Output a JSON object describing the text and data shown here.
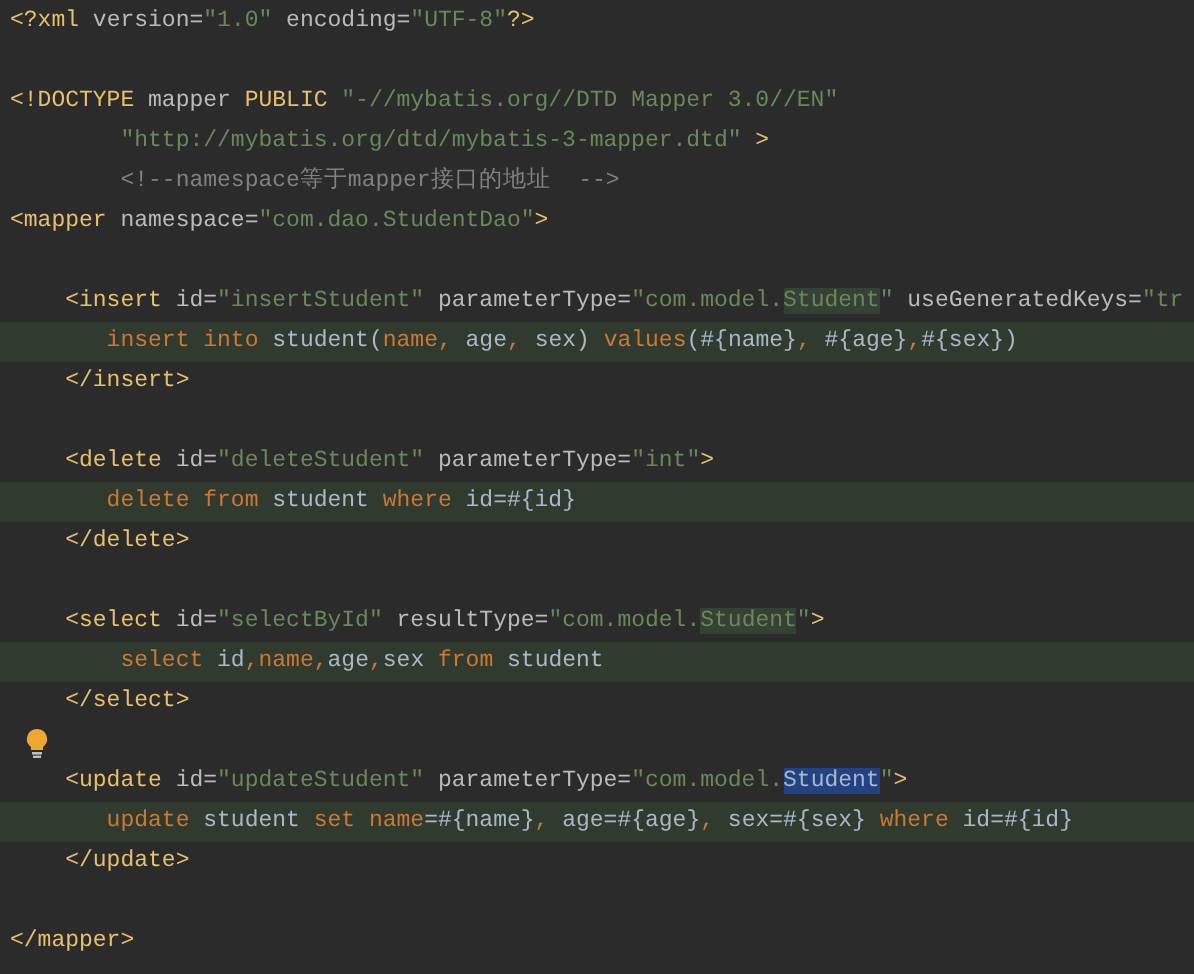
{
  "editor": {
    "lines": [
      {
        "kind": "code",
        "injected": false,
        "segments": [
          {
            "text": "<?xml",
            "kind": "tag"
          },
          {
            "text": " version=",
            "kind": "attr"
          },
          {
            "text": "\"1.0\"",
            "kind": "value"
          },
          {
            "text": " encoding=",
            "kind": "attr"
          },
          {
            "text": "\"UTF-8\"",
            "kind": "value"
          },
          {
            "text": "?>",
            "kind": "tag"
          }
        ]
      },
      {
        "kind": "blank"
      },
      {
        "kind": "code",
        "injected": false,
        "segments": [
          {
            "text": "<!DOCTYPE",
            "kind": "tag"
          },
          {
            "text": " mapper",
            "kind": "attr"
          },
          {
            "text": " PUBLIC",
            "kind": "tag"
          },
          {
            "text": " \"-//mybatis.org//DTD Mapper 3.0//EN\"",
            "kind": "value"
          }
        ]
      },
      {
        "kind": "code",
        "injected": false,
        "segments": [
          {
            "text": "        \"http://mybatis.org/dtd/mybatis-3-mapper.dtd\"",
            "kind": "value"
          },
          {
            "text": " >",
            "kind": "tag"
          }
        ]
      },
      {
        "kind": "code",
        "injected": false,
        "segments": [
          {
            "text": "        <!--namespace等于mapper接口的地址  -->",
            "kind": "comment"
          }
        ]
      },
      {
        "kind": "code",
        "injected": false,
        "segments": [
          {
            "text": "<mapper",
            "kind": "tag"
          },
          {
            "text": " namespace=",
            "kind": "attr"
          },
          {
            "text": "\"com.dao.StudentDao\"",
            "kind": "value"
          },
          {
            "text": ">",
            "kind": "tag"
          }
        ]
      },
      {
        "kind": "blank"
      },
      {
        "kind": "code",
        "injected": false,
        "segments": [
          {
            "text": "    <insert",
            "kind": "tag"
          },
          {
            "text": " id=",
            "kind": "attr"
          },
          {
            "text": "\"insertStudent\"",
            "kind": "value"
          },
          {
            "text": " parameterType=",
            "kind": "attr"
          },
          {
            "text": "\"com.model.",
            "kind": "value"
          },
          {
            "text": "Student",
            "kind": "reference"
          },
          {
            "text": "\"",
            "kind": "value"
          },
          {
            "text": " useGeneratedKeys=",
            "kind": "attr"
          },
          {
            "text": "\"tr",
            "kind": "value"
          }
        ]
      },
      {
        "kind": "code",
        "injected": true,
        "segments": [
          {
            "text": "       insert into",
            "kind": "keyword"
          },
          {
            "text": " student(",
            "kind": "text"
          },
          {
            "text": "name, ",
            "kind": "keyword"
          },
          {
            "text": "age",
            "kind": "text"
          },
          {
            "text": ", ",
            "kind": "keyword"
          },
          {
            "text": "sex) ",
            "kind": "text"
          },
          {
            "text": "values",
            "kind": "keyword"
          },
          {
            "text": "(#{name}",
            "kind": "text"
          },
          {
            "text": ", ",
            "kind": "keyword"
          },
          {
            "text": "#{age}",
            "kind": "text"
          },
          {
            "text": ",",
            "kind": "keyword"
          },
          {
            "text": "#{sex})",
            "kind": "text"
          }
        ]
      },
      {
        "kind": "code",
        "injected": false,
        "segments": [
          {
            "text": "    </insert>",
            "kind": "tag"
          }
        ]
      },
      {
        "kind": "blank"
      },
      {
        "kind": "code",
        "injected": false,
        "segments": [
          {
            "text": "    <delete",
            "kind": "tag"
          },
          {
            "text": " id=",
            "kind": "attr"
          },
          {
            "text": "\"deleteStudent\"",
            "kind": "value"
          },
          {
            "text": " parameterType=",
            "kind": "attr"
          },
          {
            "text": "\"int\"",
            "kind": "value"
          },
          {
            "text": ">",
            "kind": "tag"
          }
        ]
      },
      {
        "kind": "code",
        "injected": true,
        "segments": [
          {
            "text": "       delete from",
            "kind": "keyword"
          },
          {
            "text": " student ",
            "kind": "text"
          },
          {
            "text": "where",
            "kind": "keyword"
          },
          {
            "text": " id=#{id}",
            "kind": "text"
          }
        ]
      },
      {
        "kind": "code",
        "injected": false,
        "segments": [
          {
            "text": "    </delete>",
            "kind": "tag"
          }
        ]
      },
      {
        "kind": "blank"
      },
      {
        "kind": "code",
        "injected": false,
        "segments": [
          {
            "text": "    <select",
            "kind": "tag"
          },
          {
            "text": " id=",
            "kind": "attr"
          },
          {
            "text": "\"selectById\"",
            "kind": "value"
          },
          {
            "text": " resultType=",
            "kind": "attr"
          },
          {
            "text": "\"com.model.",
            "kind": "value"
          },
          {
            "text": "Student",
            "kind": "reference"
          },
          {
            "text": "\"",
            "kind": "value"
          },
          {
            "text": ">",
            "kind": "tag"
          }
        ]
      },
      {
        "kind": "code",
        "injected": true,
        "segments": [
          {
            "text": "        select",
            "kind": "keyword"
          },
          {
            "text": " id",
            "kind": "text"
          },
          {
            "text": ",name,",
            "kind": "keyword"
          },
          {
            "text": "age",
            "kind": "text"
          },
          {
            "text": ",",
            "kind": "keyword"
          },
          {
            "text": "sex ",
            "kind": "text"
          },
          {
            "text": "from",
            "kind": "keyword"
          },
          {
            "text": " student",
            "kind": "text"
          }
        ]
      },
      {
        "kind": "code",
        "injected": false,
        "segments": [
          {
            "text": "    </select>",
            "kind": "tag"
          }
        ]
      },
      {
        "kind": "bulb"
      },
      {
        "kind": "code",
        "injected": false,
        "segments": [
          {
            "text": "    <update",
            "kind": "tag"
          },
          {
            "text": " id=",
            "kind": "attr"
          },
          {
            "text": "\"updateStudent\"",
            "kind": "value"
          },
          {
            "text": " parameterType=",
            "kind": "attr"
          },
          {
            "text": "\"com.model.",
            "kind": "value"
          },
          {
            "text": "Student",
            "kind": "selection"
          },
          {
            "text": "\"",
            "kind": "value"
          },
          {
            "text": ">",
            "kind": "tag"
          }
        ]
      },
      {
        "kind": "code",
        "injected": true,
        "segments": [
          {
            "text": "       update",
            "kind": "keyword"
          },
          {
            "text": " student ",
            "kind": "text"
          },
          {
            "text": "set name",
            "kind": "keyword"
          },
          {
            "text": "=#{name}",
            "kind": "text"
          },
          {
            "text": ", ",
            "kind": "keyword"
          },
          {
            "text": "age=#{age}",
            "kind": "text"
          },
          {
            "text": ", ",
            "kind": "keyword"
          },
          {
            "text": "sex=#{sex} ",
            "kind": "text"
          },
          {
            "text": "where",
            "kind": "keyword"
          },
          {
            "text": " id=#{id}",
            "kind": "text"
          }
        ]
      },
      {
        "kind": "code",
        "injected": false,
        "segments": [
          {
            "text": "    </update>",
            "kind": "tag"
          }
        ]
      },
      {
        "kind": "blank"
      },
      {
        "kind": "code",
        "injected": false,
        "segments": [
          {
            "text": "</mapper>",
            "kind": "tag"
          }
        ]
      }
    ]
  }
}
